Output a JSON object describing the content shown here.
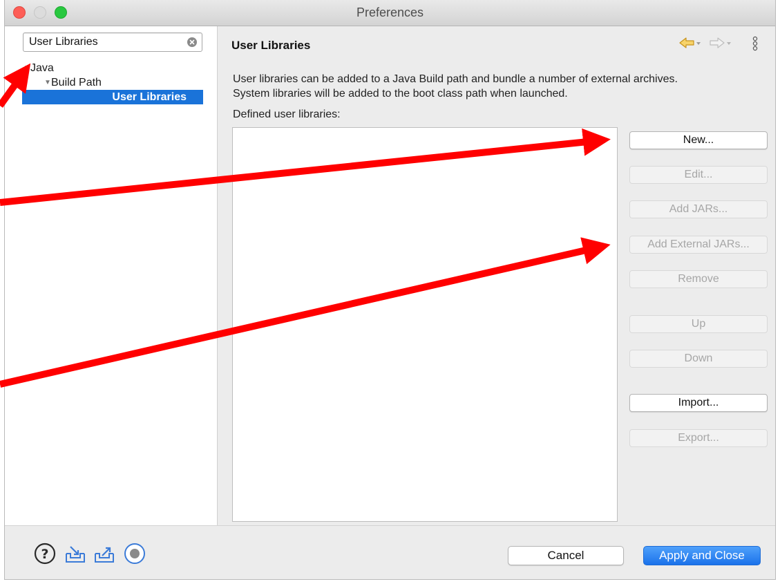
{
  "window": {
    "title": "Preferences"
  },
  "sidebar": {
    "search": {
      "value": "User Libraries",
      "placeholder": ""
    },
    "tree": [
      {
        "label": "Java",
        "level": 0,
        "expanded": true
      },
      {
        "label": "Build Path",
        "level": 1,
        "expanded": true
      },
      {
        "label": "User Libraries",
        "level": 2,
        "selected": true
      }
    ]
  },
  "main": {
    "title": "User Libraries",
    "description_line1": "User libraries can be added to a Java Build path and bundle a number of external archives.",
    "description_line2": "System libraries will be added to the boot class path when launched.",
    "list_label": "Defined user libraries:",
    "buttons": {
      "new": "New...",
      "edit": "Edit...",
      "add_jars": "Add JARs...",
      "add_external_jars": "Add External JARs...",
      "remove": "Remove",
      "up": "Up",
      "down": "Down",
      "import": "Import...",
      "export": "Export..."
    }
  },
  "footer": {
    "cancel_label": "Cancel",
    "apply_label": "Apply and Close",
    "icons": [
      "help-icon",
      "import-preferences-icon",
      "export-preferences-icon",
      "record-icon"
    ]
  },
  "colors": {
    "selection": "#1a73d9",
    "primary_button": "#1b72ea",
    "annotation_arrow": "#ff0000"
  }
}
